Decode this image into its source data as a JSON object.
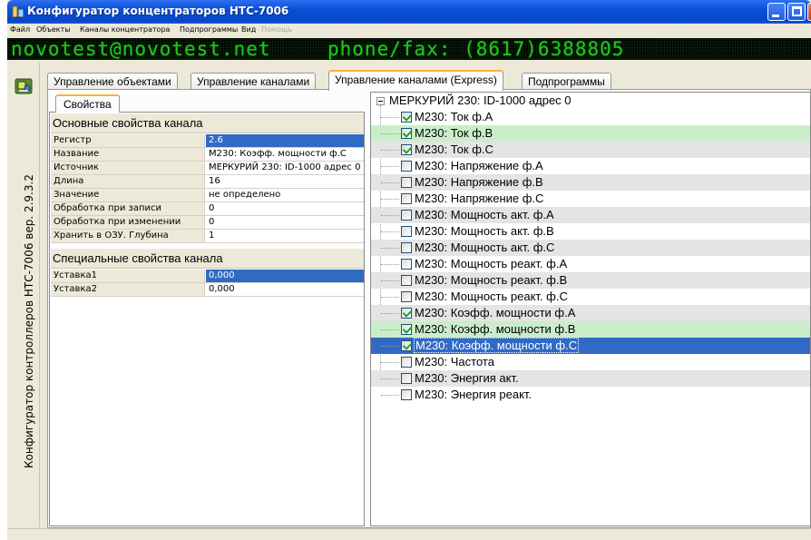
{
  "window": {
    "title": "Конфигуратор концентраторов НТС-7006"
  },
  "menu": [
    {
      "label": "Файл",
      "enabled": true
    },
    {
      "label": "Объекты",
      "enabled": true
    },
    {
      "label": "Каналы концентратора",
      "enabled": true
    },
    {
      "label": "Подпрограммы",
      "enabled": true
    },
    {
      "label": "Вид",
      "enabled": true
    },
    {
      "label": "Помощь",
      "enabled": false
    }
  ],
  "banner": {
    "email": "novotest@novotest.net",
    "phone": "phone/fax: (8617)6388805"
  },
  "sidebar": {
    "caption": "Конфигуратор контроллеров НТС-7006 вер. 2.9.3.2",
    "icon": "app-config-icon"
  },
  "tabs": [
    {
      "label": "Управление объектами",
      "active": false
    },
    {
      "label": "Управление каналами",
      "active": false
    },
    {
      "label": "Управление каналами (Express)",
      "active": true
    },
    {
      "label": "Подпрограммы",
      "active": false
    }
  ],
  "left_panel": {
    "sub_tab": "Свойства",
    "basic_section": "Основные свойства канала",
    "basic_props": [
      {
        "name": "Регистр",
        "value": "2.6",
        "selected": true
      },
      {
        "name": "Название",
        "value": "М230: Коэфф. мощности ф.C",
        "selected": false
      },
      {
        "name": "Источник",
        "value": "МЕРКУРИЙ 230: ID-1000 адрес 0",
        "selected": false
      },
      {
        "name": "Длина",
        "value": "16",
        "selected": false
      },
      {
        "name": "Значение",
        "value": "не определено",
        "selected": false
      },
      {
        "name": "Обработка при записи",
        "value": "0",
        "selected": false
      },
      {
        "name": "Обработка при изменении",
        "value": "0",
        "selected": false
      },
      {
        "name": "Хранить в ОЗУ. Глубина",
        "value": "1",
        "selected": false
      }
    ],
    "special_section": "Специальные свойства канала",
    "special_props": [
      {
        "name": "Уставка1",
        "value": "0,000",
        "selected": true
      },
      {
        "name": "Уставка2",
        "value": "0,000",
        "selected": false
      }
    ]
  },
  "tree": {
    "root": "МЕРКУРИЙ 230: ID-1000 адрес 0",
    "items": [
      {
        "label": "M230: Ток ф.A",
        "checked": true,
        "state": "plain"
      },
      {
        "label": "M230: Ток ф.B",
        "checked": true,
        "state": "green"
      },
      {
        "label": "M230: Ток ф.C",
        "checked": true,
        "state": "stripe"
      },
      {
        "label": "M230: Напряжение ф.A",
        "checked": false,
        "state": "plain"
      },
      {
        "label": "M230: Напряжение ф.B",
        "checked": false,
        "state": "stripe"
      },
      {
        "label": "M230: Напряжение ф.C",
        "checked": false,
        "state": "plain"
      },
      {
        "label": "M230: Мощность акт. ф.A",
        "checked": false,
        "state": "stripe"
      },
      {
        "label": "M230: Мощность акт. ф.B",
        "checked": false,
        "state": "plain"
      },
      {
        "label": "M230: Мощность акт. ф.C",
        "checked": false,
        "state": "stripe"
      },
      {
        "label": "M230: Мощность реакт. ф.A",
        "checked": false,
        "state": "plain"
      },
      {
        "label": "M230: Мощность реакт. ф.B",
        "checked": false,
        "state": "stripe"
      },
      {
        "label": "M230: Мощность реакт. ф.C",
        "checked": false,
        "state": "plain"
      },
      {
        "label": "M230: Коэфф. мощности ф.A",
        "checked": true,
        "state": "stripe"
      },
      {
        "label": "M230: Коэфф. мощности ф.B",
        "checked": true,
        "state": "green"
      },
      {
        "label": "M230: Коэфф. мощности ф.C",
        "checked": true,
        "state": "selected"
      },
      {
        "label": "M230: Частота",
        "checked": false,
        "state": "plain"
      },
      {
        "label": "M230: Энергия акт.",
        "checked": false,
        "state": "stripe"
      },
      {
        "label": "M230: Энергия реакт.",
        "checked": false,
        "state": "plain"
      }
    ]
  },
  "colors": {
    "selection": "#316ac5",
    "green_highlight": "#c9eec9",
    "stripe": "#e4e4e4",
    "led_text": "#22c022"
  }
}
